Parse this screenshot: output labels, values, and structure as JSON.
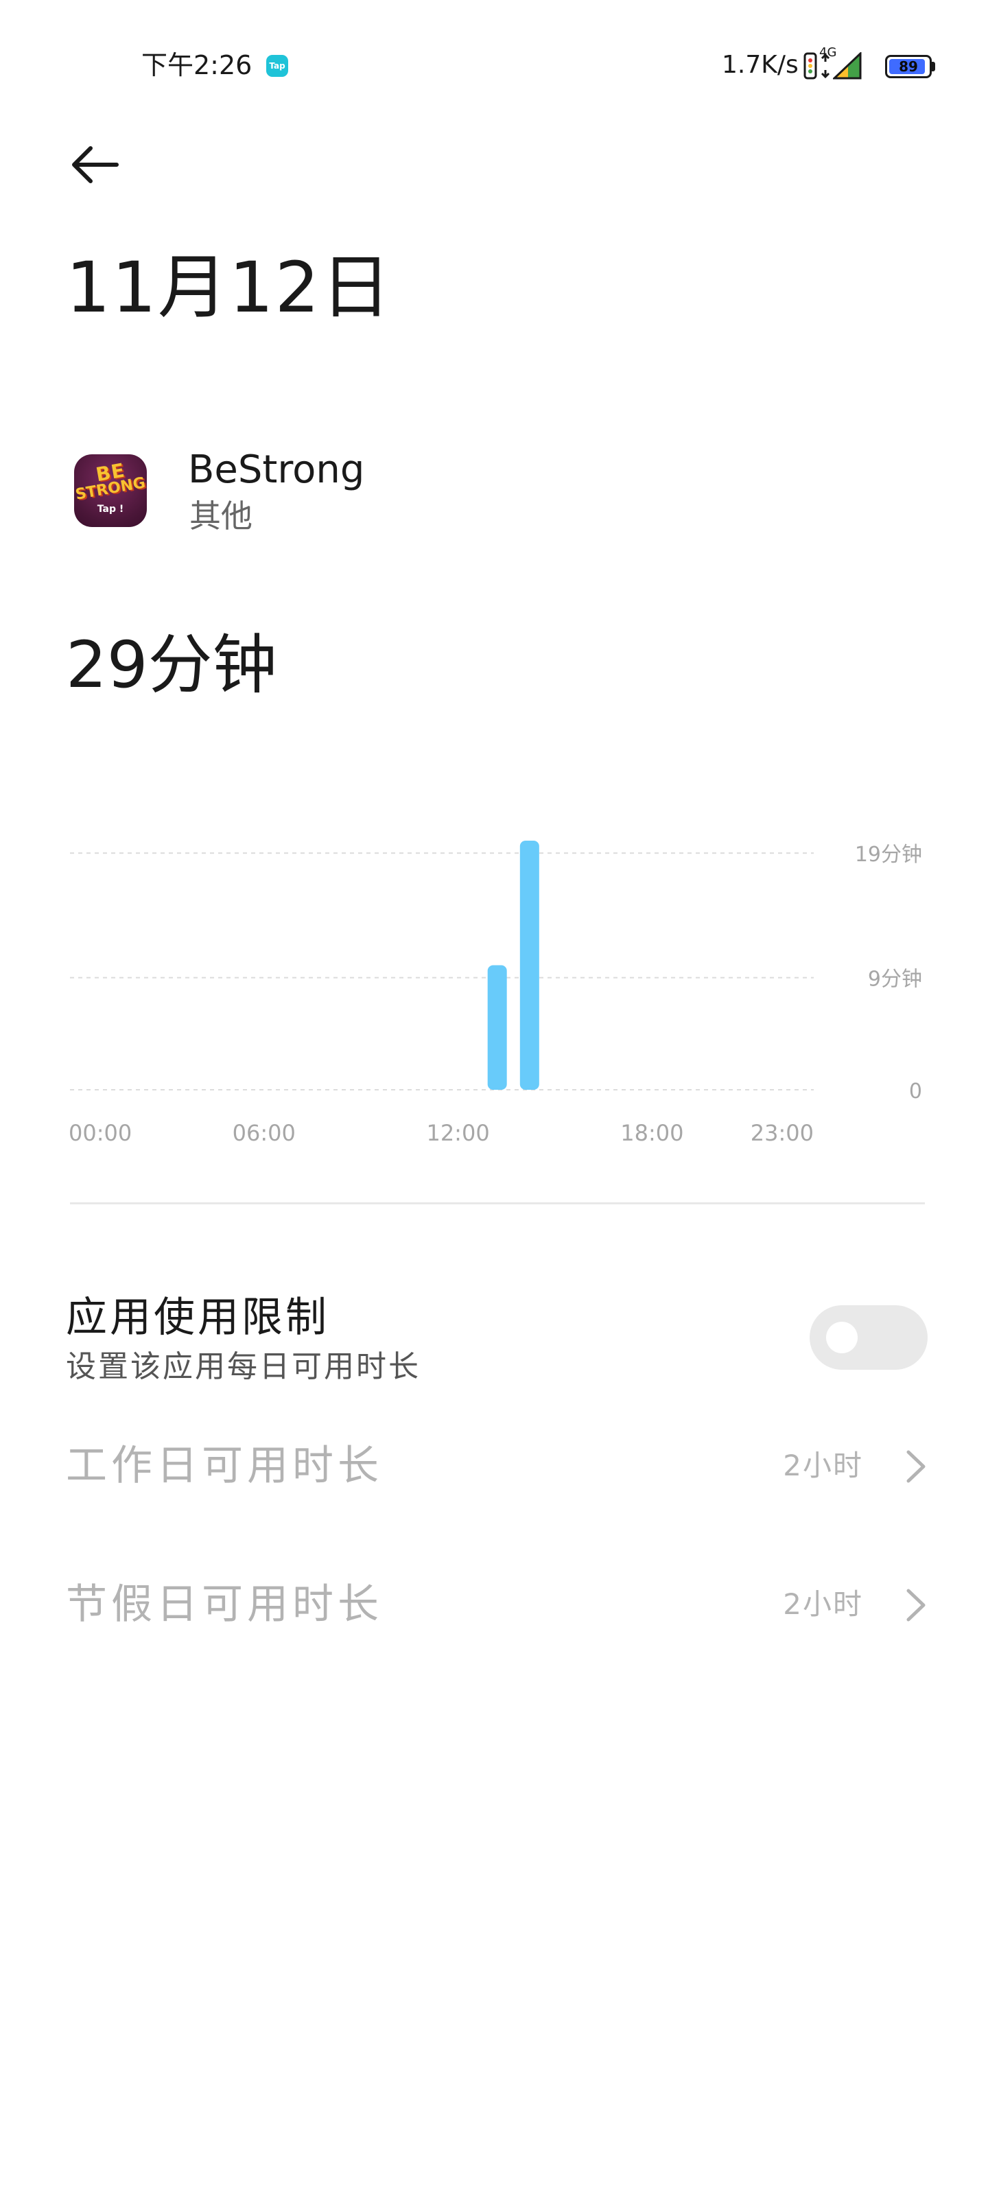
{
  "status_bar": {
    "time": "下午2:26",
    "notification_badge": "Tap",
    "network_speed": "1.7K/s",
    "network_type": "4G",
    "battery_level": "89",
    "icons": [
      "vibrate-icon",
      "data-arrows-icon",
      "signal-icon",
      "battery-icon"
    ]
  },
  "header": {
    "back_icon": "arrow-left-icon",
    "date_title": "11月12日"
  },
  "app": {
    "name": "BeStrong",
    "category": "其他",
    "icon_text_top": "BE",
    "icon_text_middle": "STRONG",
    "icon_text_bottom": "Tap !"
  },
  "total_usage": "29分钟",
  "chart_data": {
    "type": "bar",
    "x": [
      "13:00",
      "14:00"
    ],
    "values": [
      10,
      20
    ],
    "value_unit": "分钟",
    "x_tick_labels": [
      "00:00",
      "06:00",
      "12:00",
      "18:00",
      "23:00"
    ],
    "y_tick_labels": [
      "19分钟",
      "9分钟",
      "0"
    ],
    "ylim": [
      0,
      20
    ],
    "grid": true,
    "bar_color": "#68cbfa"
  },
  "usage_limit": {
    "title": "应用使用限制",
    "subtitle": "设置该应用每日可用时长",
    "enabled": false
  },
  "rows": [
    {
      "label": "工作日可用时长",
      "value": "2小时"
    },
    {
      "label": "节假日可用时长",
      "value": "2小时"
    }
  ],
  "colors": {
    "text_primary": "#1a1a1a",
    "text_disabled": "#b3b3b3",
    "chart_bar": "#68cbfa",
    "toggle_off": "#e9e9e9"
  }
}
